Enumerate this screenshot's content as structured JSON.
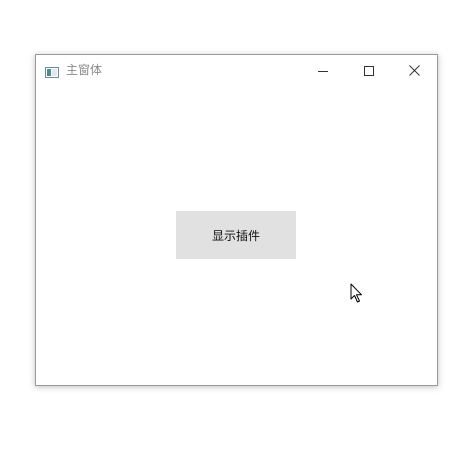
{
  "window": {
    "title": "主窗体"
  },
  "main": {
    "show_plugin_button_label": "显示插件"
  },
  "icons": {
    "app": "app-window-icon",
    "minimize": "minimize-icon",
    "maximize": "maximize-icon",
    "close": "close-icon",
    "cursor": "mouse-pointer-icon"
  },
  "colors": {
    "button_bg": "#e1e1e1",
    "title_text": "#8a8a8a",
    "window_border": "#9a9a9a"
  }
}
